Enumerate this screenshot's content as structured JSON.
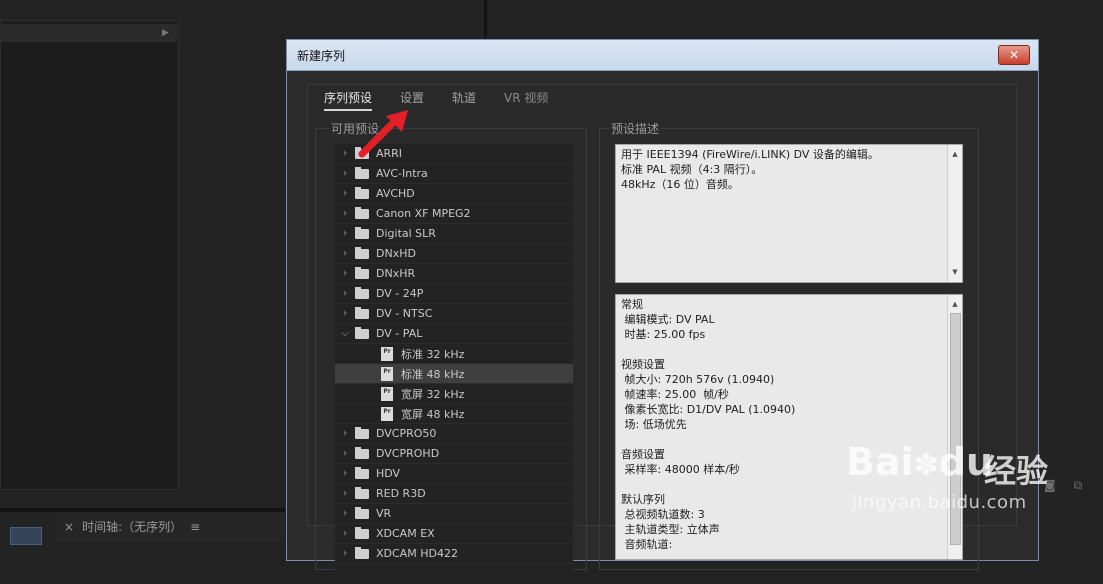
{
  "background": {
    "timeline_tab": {
      "close": "×",
      "label": "时间轴:（无序列）",
      "menu": "≡"
    },
    "panel_arrow": "▶"
  },
  "dialog": {
    "title": "新建序列",
    "close_label": "✕",
    "tabs": [
      {
        "label": "序列预设",
        "active": true
      },
      {
        "label": "设置"
      },
      {
        "label": "轨道"
      },
      {
        "label": "VR 视频"
      }
    ],
    "presets_label": "可用预设",
    "description_label": "预设描述",
    "presets": [
      {
        "label": "ARRI",
        "type": "folder",
        "expanded": false
      },
      {
        "label": "AVC-Intra",
        "type": "folder",
        "expanded": false
      },
      {
        "label": "AVCHD",
        "type": "folder",
        "expanded": false
      },
      {
        "label": "Canon XF MPEG2",
        "type": "folder",
        "expanded": false
      },
      {
        "label": "Digital SLR",
        "type": "folder",
        "expanded": false
      },
      {
        "label": "DNxHD",
        "type": "folder",
        "expanded": false
      },
      {
        "label": "DNxHR",
        "type": "folder",
        "expanded": false
      },
      {
        "label": "DV - 24P",
        "type": "folder",
        "expanded": false
      },
      {
        "label": "DV - NTSC",
        "type": "folder",
        "expanded": false
      },
      {
        "label": "DV - PAL",
        "type": "folder",
        "expanded": true
      },
      {
        "label": "标准 32 kHz",
        "type": "preset"
      },
      {
        "label": "标准 48 kHz",
        "type": "preset",
        "selected": true
      },
      {
        "label": "宽屏 32 kHz",
        "type": "preset"
      },
      {
        "label": "宽屏 48 kHz",
        "type": "preset"
      },
      {
        "label": "DVCPRO50",
        "type": "folder",
        "expanded": false
      },
      {
        "label": "DVCPROHD",
        "type": "folder",
        "expanded": false
      },
      {
        "label": "HDV",
        "type": "folder",
        "expanded": false
      },
      {
        "label": "RED R3D",
        "type": "folder",
        "expanded": false
      },
      {
        "label": "VR",
        "type": "folder",
        "expanded": false
      },
      {
        "label": "XDCAM EX",
        "type": "folder",
        "expanded": false
      },
      {
        "label": "XDCAM HD422",
        "type": "folder",
        "expanded": false
      }
    ],
    "description_lines": [
      "用于 IEEE1394 (FireWire/i.LINK) DV 设备的编辑。",
      "标准 PAL 视频（4:3 隔行）。",
      "48kHz（16 位）音频。"
    ],
    "details_lines": [
      "常规",
      " 编辑模式: DV PAL",
      " 时基: 25.00 fps",
      "",
      "视频设置",
      " 帧大小: 720h 576v (1.0940)",
      " 帧速率: 25.00  帧/秒",
      " 像素长宽比: D1/DV PAL (1.0940)",
      " 场: 低场优先",
      "",
      "音频设置",
      " 采样率: 48000 样本/秒",
      "",
      "默认序列",
      " 总视频轨道数: 3",
      " 主轨道类型: 立体声",
      " 音频轨道:"
    ],
    "scroll_up": "▲",
    "scroll_down": "▼"
  },
  "watermark": {
    "logo": "Bai",
    "logo_tail": "du",
    "cn": "经验",
    "url": "jingyan.baidu.com"
  },
  "colors": {
    "annotation_arrow": "#e3202a",
    "selection": "#3f3f3f",
    "titlebar": "#cfdcee"
  }
}
